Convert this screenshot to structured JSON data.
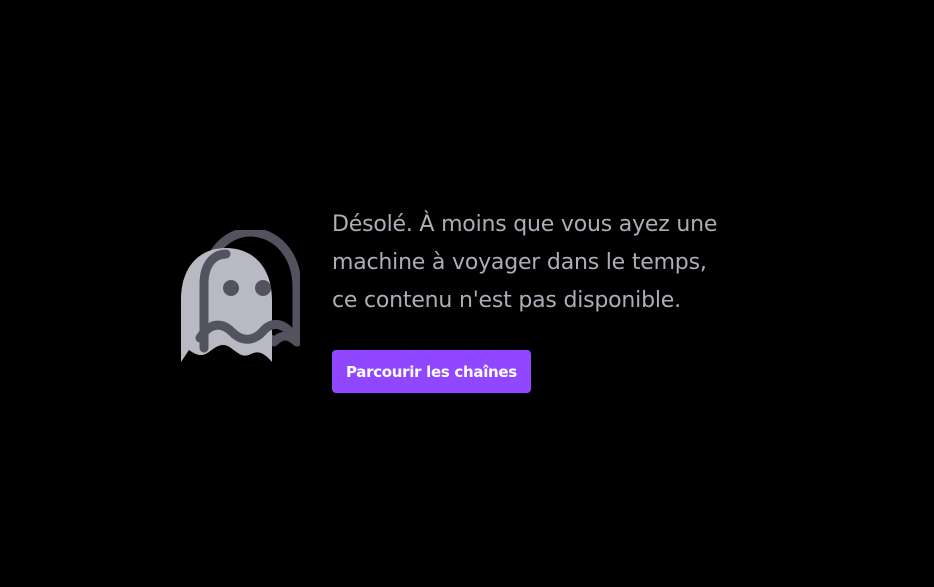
{
  "error": {
    "icon": "ghost-icon",
    "message_lines": [
      "Désolé. À moins que vous ayez une",
      "machine à voyager dans le temps,",
      "ce contenu n'est pas disponible."
    ],
    "button_label": "Parcourir les chaînes"
  },
  "colors": {
    "background": "#000000",
    "text": "#adadb8",
    "accent": "#9147ff",
    "ghost_body": "#b9b9c4",
    "ghost_outline": "#53535f"
  }
}
